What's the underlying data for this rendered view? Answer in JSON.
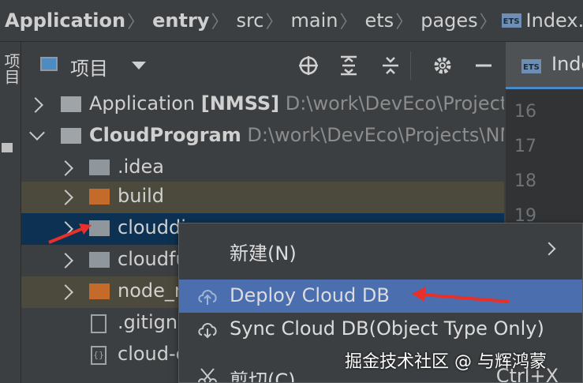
{
  "breadcrumb": {
    "items": [
      "Application",
      "entry",
      "src",
      "main",
      "ets",
      "pages",
      "Index.ets"
    ],
    "file_badge": "ETS"
  },
  "left_strip": {
    "label": "项目"
  },
  "project_panel": {
    "title": "项目",
    "toolbar_icons": [
      "locate-icon",
      "expand-all-icon",
      "collapse-all-icon",
      "gear-icon",
      "hide-icon"
    ]
  },
  "tree": {
    "rows": [
      {
        "name": "Application",
        "suffix": "[NMSS]",
        "path": "D:\\work\\DevEco\\Projects\\"
      },
      {
        "name": "CloudProgram",
        "path": "D:\\work\\DevEco\\Projects\\NM"
      },
      {
        "name": ".idea"
      },
      {
        "name": "build"
      },
      {
        "name": "clouddi"
      },
      {
        "name": "cloudfu"
      },
      {
        "name": "node_m"
      },
      {
        "name": ".gitigno"
      },
      {
        "name": "cloud-c"
      }
    ]
  },
  "editor": {
    "tab_label": "Inde",
    "tab_badge": "ETS",
    "line_numbers": [
      "16",
      "17",
      "18",
      "19"
    ]
  },
  "context_menu": {
    "items": [
      {
        "label": "新建(N)",
        "has_submenu": true
      },
      {
        "label": "Deploy Cloud DB",
        "highlighted": true
      },
      {
        "label": "Sync Cloud DB(Object Type Only)"
      },
      {
        "label": "剪切(C)",
        "shortcut": "Ctrl+X"
      }
    ]
  },
  "watermark": "掘金技术社区 @ 与辉鸿蒙",
  "colors": {
    "background": "#3c3f41",
    "selection": "#0d3152",
    "menu_highlight": "#4b6eaf",
    "excluded_folder": "#c46a2a",
    "annotation_arrow": "#e8302a"
  }
}
